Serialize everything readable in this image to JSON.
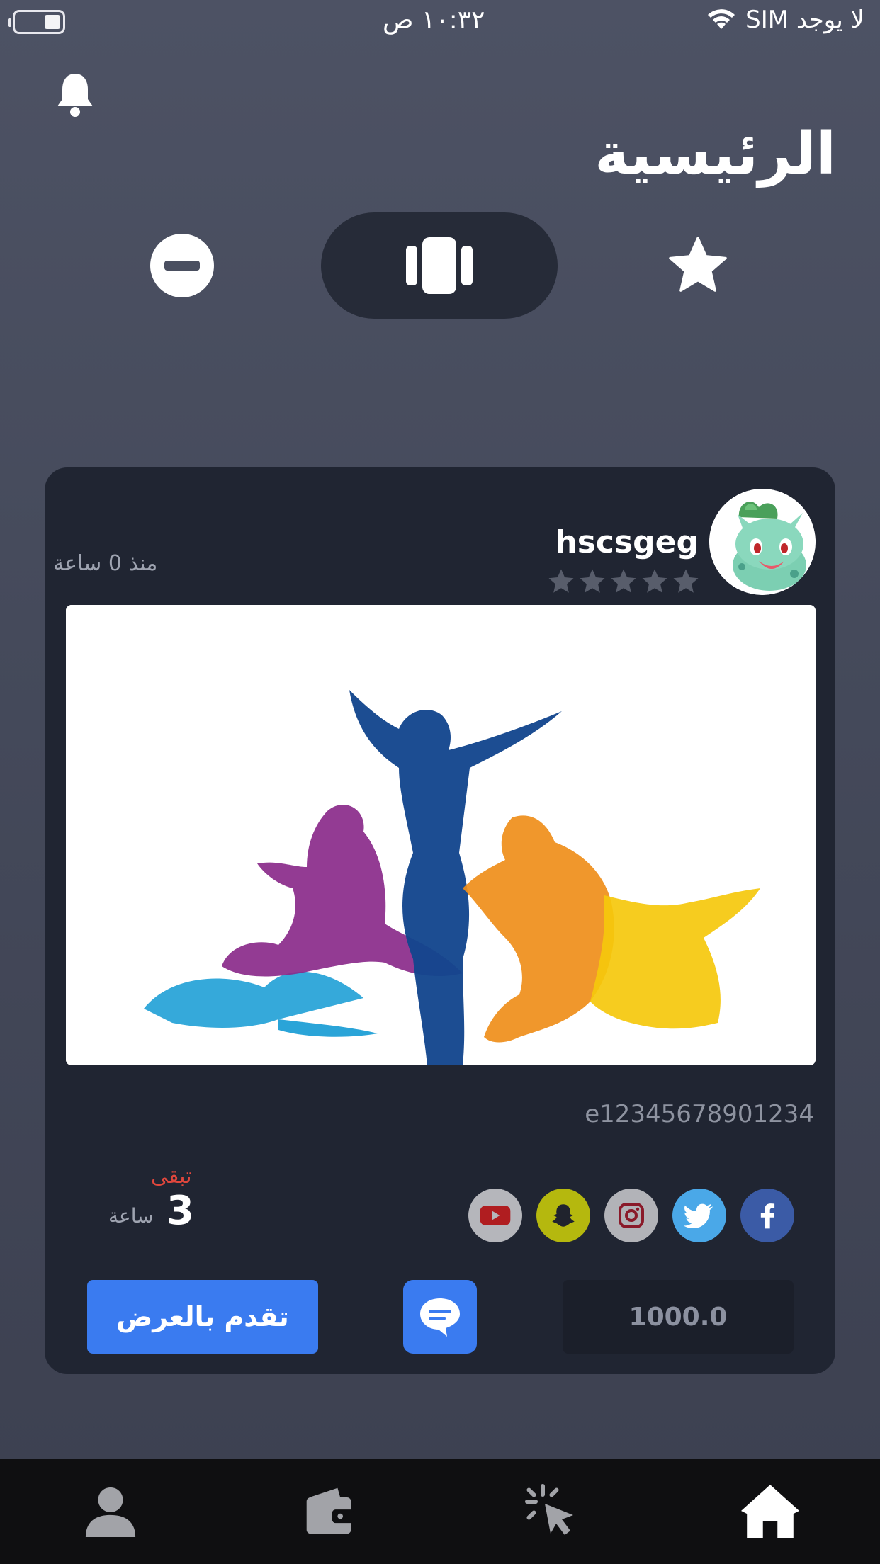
{
  "status_bar": {
    "time": "١٠:٣٢ ص",
    "carrier": "لا يوجد SIM",
    "icons": [
      "battery-icon",
      "wifi-icon"
    ]
  },
  "header": {
    "title": "الرئيسية",
    "icons": [
      "bell-icon"
    ]
  },
  "toolbar": {
    "items": [
      {
        "icon": "block-icon",
        "selected": false
      },
      {
        "icon": "cards-icon",
        "selected": true
      },
      {
        "icon": "star-icon",
        "selected": false
      }
    ]
  },
  "post": {
    "username": "hscsgeg",
    "time_ago": "منذ 0 ساعة",
    "rating": 0,
    "rating_max": 5,
    "avatar_icon": "pokemon-avatar",
    "image_icon": "dancers-illustration",
    "code": "e12345678901234",
    "social_icons": [
      "youtube-icon",
      "snapchat-icon",
      "instagram-icon",
      "twitter-icon",
      "facebook-icon"
    ],
    "remaining_label": "تبقى",
    "remaining_value": "3",
    "remaining_unit": "ساعة",
    "bid_button_label": "تقدم بالعرض",
    "amount_value": "1000.0"
  },
  "colors": {
    "background_top": "#4d5264",
    "card": "#202532",
    "accent": "#3a7bf0",
    "remaining_label": "#e0473d",
    "tab_bar": "#0f0f11"
  },
  "tab_bar": {
    "items": [
      {
        "icon": "profile-icon",
        "active": false
      },
      {
        "icon": "wallet-icon",
        "active": false
      },
      {
        "icon": "click-icon",
        "active": false
      },
      {
        "icon": "home-icon",
        "active": true
      }
    ]
  }
}
